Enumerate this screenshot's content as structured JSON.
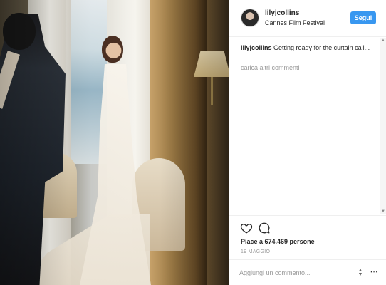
{
  "post": {
    "username": "lilyjcollins",
    "location": "Cannes Film Festival",
    "follow_label": "Segui",
    "caption_user": "lilyjcollins",
    "caption_text": "Getting ready for the curtain call...",
    "load_more": "carica altri commenti",
    "likes": "Piace a 674.469 persone",
    "date": "19 MAGGIO"
  },
  "comment_box": {
    "placeholder": "Aggiungi un commento..."
  },
  "icons": {
    "like": "heart-icon",
    "comment": "comment-bubble-icon",
    "options": "more-options-icon"
  },
  "colors": {
    "follow_button": "#3897f0",
    "muted_text": "#999999",
    "text": "#262626"
  }
}
